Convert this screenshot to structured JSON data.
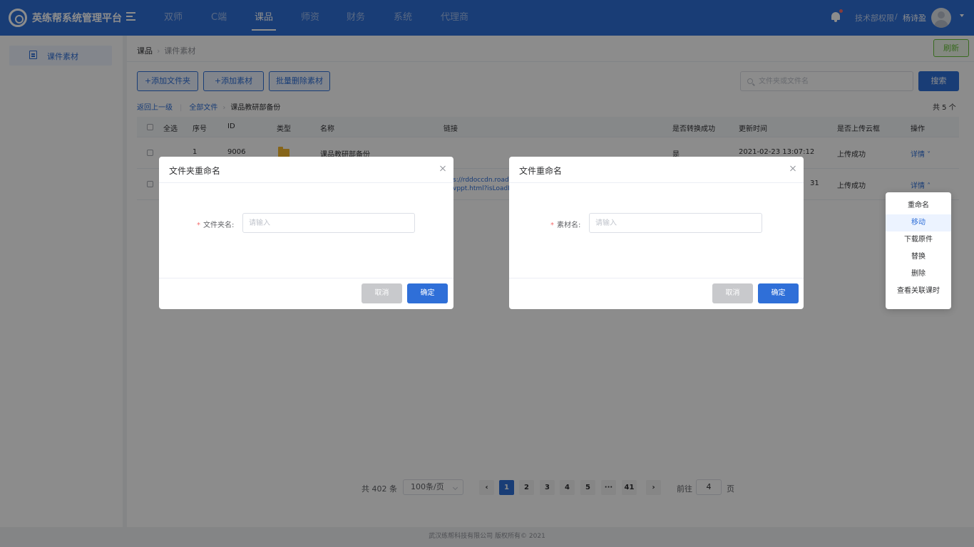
{
  "header": {
    "app_title": "英练帮系统管理平台",
    "nav": [
      "双师",
      "C端",
      "课品",
      "师资",
      "财务",
      "系统",
      "代理商"
    ],
    "permission": "技术部权限",
    "separator": "/",
    "username": "杨诗盈"
  },
  "sidebar": {
    "items": [
      {
        "label": "课件素材",
        "icon": "document-icon"
      }
    ]
  },
  "breadcrumb": {
    "root": "课品",
    "current": "课件素材"
  },
  "refresh_label": "刷新",
  "toolbar": {
    "add_folder": "+添加文件夹",
    "add_material": "+添加素材",
    "batch_delete": "批量删除素材",
    "search_placeholder": "文件夹或文件名",
    "search_label": "搜索"
  },
  "path": {
    "back": "返回上一级",
    "all_files": "全部文件",
    "current_folder": "课品教研部备份",
    "total": "共 5 个"
  },
  "table": {
    "headers": {
      "select_all": "全选",
      "index": "序号",
      "id": "ID",
      "type": "类型",
      "name": "名称",
      "link": "链接",
      "converted": "是否转换成功",
      "updated": "更新时间",
      "uploaded": "是否上传云框",
      "ops": "操作"
    },
    "rows": [
      {
        "index": "1",
        "id": "9006",
        "type_icon": "folder-icon",
        "name": "课品教研部备份",
        "link_1": "",
        "link_2": "",
        "converted": "是",
        "updated": "2021-02-23  13:07:12",
        "uploaded": "上传成功",
        "ops": "详情 ˅"
      },
      {
        "index": "",
        "id": "",
        "type_icon": "",
        "name": "",
        "link_1": "s://rddoccdn.roadc",
        "link_2": "vppt.html?isLoadPa",
        "converted": "",
        "updated": "31",
        "uploaded": "上传成功",
        "ops": "详情 ˄"
      }
    ]
  },
  "pagination": {
    "total": "共 402 条",
    "page_size": "100条/页",
    "prev": "‹",
    "pages": [
      "1",
      "2",
      "3",
      "4",
      "5",
      "···",
      "41"
    ],
    "next": "›",
    "current_page": "1",
    "goto_label": "前往",
    "goto_value": "4",
    "page_suffix": "页"
  },
  "footer": "武汉练帮科技有限公司 版权所有© 2021",
  "dialog_folder": {
    "title": "文件夹重命名",
    "required_mark": "*",
    "label": "文件夹名:",
    "placeholder": "请输入",
    "cancel": "取消",
    "confirm": "确定"
  },
  "dialog_file": {
    "title": "文件重命名",
    "required_mark": "*",
    "label": "素材名:",
    "placeholder": "请输入",
    "cancel": "取消",
    "confirm": "确定"
  },
  "dropdown": {
    "items": [
      "重命名",
      "移动",
      "下载原件",
      "替换",
      "删除",
      "查看关联课时"
    ],
    "hovered": "移动"
  },
  "colors": {
    "brand": "#2f6fd8",
    "success": "#67c23a",
    "danger": "#f56c6c",
    "folder": "#f5b82e"
  }
}
